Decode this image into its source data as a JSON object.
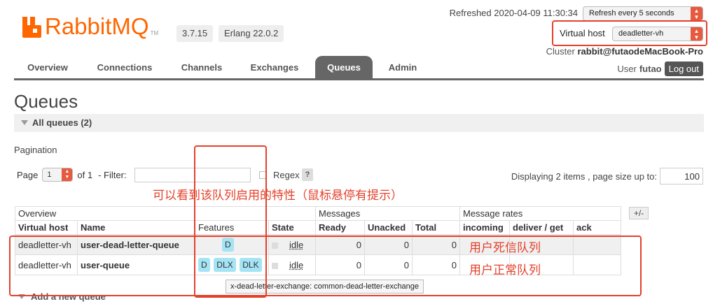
{
  "header": {
    "logo_text": "RabbitMQ",
    "logo_tm": "TM",
    "version": "3.7.15",
    "erlang": "Erlang 22.0.2",
    "refreshed": "Refreshed 2020-04-09 11:30:34",
    "refresh_select": "Refresh every 5 seconds",
    "vhost_label": "Virtual host",
    "vhost_select": "deadletter-vh",
    "cluster_label": "Cluster",
    "cluster_name": "rabbit@futaodeMacBook-Pro",
    "user_label": "User",
    "user_name": "futao",
    "logout_label": "Log out"
  },
  "nav": {
    "tabs": [
      {
        "label": "Overview"
      },
      {
        "label": "Connections"
      },
      {
        "label": "Channels"
      },
      {
        "label": "Exchanges"
      },
      {
        "label": "Queues"
      },
      {
        "label": "Admin"
      }
    ],
    "active": "Queues"
  },
  "page": {
    "title": "Queues",
    "section_label": "All queues (2)",
    "pagination_label": "Pagination",
    "page_label": "Page",
    "page_value": "1",
    "of_label": "of 1",
    "filter_label": "- Filter:",
    "regex_label": "Regex",
    "help_label": "?",
    "displaying": "Displaying 2 items , page size up to:",
    "page_size": "100",
    "plusminus": "+/-",
    "add_queue": "Add a new queue"
  },
  "annotations": {
    "features_note": "可以看到该队列启用的特性（鼠标悬停有提示）",
    "row1_note": "用户死信队列",
    "row2_note": "用户正常队列",
    "accent": "#e5402b"
  },
  "table": {
    "groups": [
      "Overview",
      "Messages",
      "Message rates"
    ],
    "columns": [
      "Virtual host",
      "Name",
      "Features",
      "State",
      "Ready",
      "Unacked",
      "Total",
      "incoming",
      "deliver / get",
      "ack"
    ],
    "rows": [
      {
        "vhost": "deadletter-vh",
        "name": "user-dead-letter-queue",
        "features": [
          "D"
        ],
        "state": "idle",
        "ready": "0",
        "unacked": "0",
        "total": "0"
      },
      {
        "vhost": "deadletter-vh",
        "name": "user-queue",
        "features": [
          "D",
          "DLX",
          "DLK"
        ],
        "state": "idle",
        "ready": "0",
        "unacked": "0",
        "total": "0"
      }
    ]
  },
  "tooltip": "x-dead-letter-exchange: common-dead-letter-exchange"
}
